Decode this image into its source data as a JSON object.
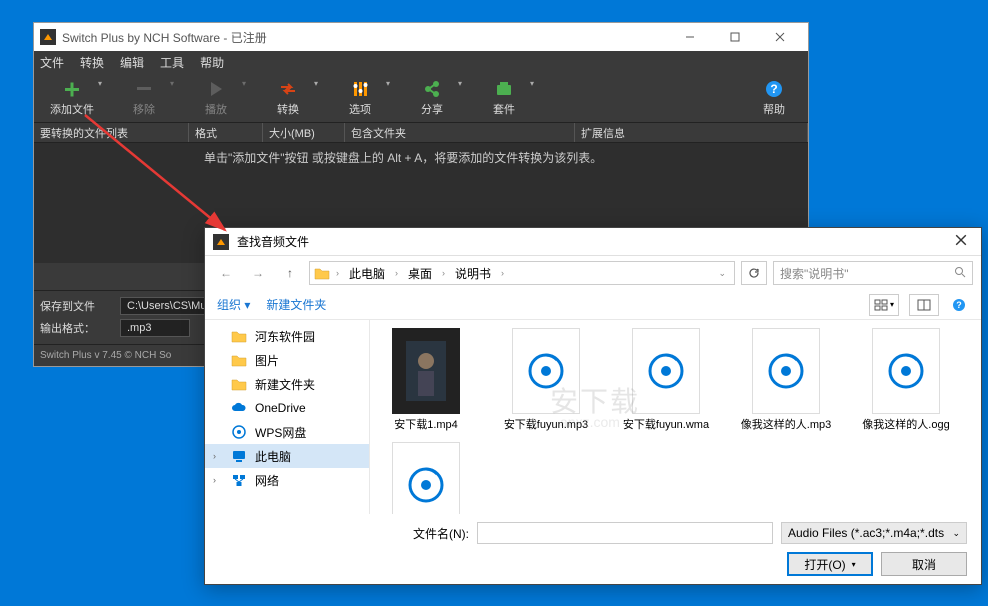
{
  "app": {
    "title": "Switch Plus by NCH Software - 已注册",
    "menu": [
      "文件",
      "转换",
      "编辑",
      "工具",
      "帮助"
    ],
    "toolbar": [
      {
        "k": "add",
        "label": "添加文件",
        "color": "#4caf50"
      },
      {
        "k": "remove",
        "label": "移除",
        "color": "#888",
        "disabled": true
      },
      {
        "k": "play",
        "label": "播放",
        "color": "#888",
        "disabled": true
      },
      {
        "k": "convert",
        "label": "转换",
        "color": "#d84315"
      },
      {
        "k": "options",
        "label": "选项",
        "color": "#ff9800"
      },
      {
        "k": "share",
        "label": "分享",
        "color": "#4caf50"
      },
      {
        "k": "suite",
        "label": "套件",
        "color": "#4caf50"
      }
    ],
    "help_label": "帮助",
    "columns": {
      "list": "要转换的文件列表",
      "format": "格式",
      "size": "大小(MB)",
      "folder": "包含文件夹",
      "ext": "扩展信息"
    },
    "hint": "单击\"添加文件\"按钮 或按键盘上的 Alt + A，将要添加的文件转换为该列表。",
    "nch": "NCH",
    "save_to_label": "保存到文件",
    "save_to_value": "C:\\Users\\CS\\Mu",
    "format_label": "输出格式：",
    "format_value": ".mp3",
    "status": "Switch Plus v 7.45 © NCH So"
  },
  "dialog": {
    "title": "查找音频文件",
    "breadcrumb": [
      "此电脑",
      "桌面",
      "说明书"
    ],
    "search_placeholder": "搜索\"说明书\"",
    "organize": "组织",
    "newfolder": "新建文件夹",
    "sidebar": [
      {
        "label": "河东软件园",
        "icon": "folder"
      },
      {
        "label": "图片",
        "icon": "folder"
      },
      {
        "label": "新建文件夹",
        "icon": "folder"
      },
      {
        "label": "OneDrive",
        "icon": "cloud"
      },
      {
        "label": "WPS网盘",
        "icon": "wps"
      },
      {
        "label": "此电脑",
        "icon": "pc",
        "selected": true,
        "expand": true
      },
      {
        "label": "网络",
        "icon": "network",
        "expand": true
      }
    ],
    "files": [
      {
        "name": "安下载1.mp4",
        "type": "video"
      },
      {
        "name": "安下载fuyun.mp3",
        "type": "audio"
      },
      {
        "name": "安下载fuyun.wma",
        "type": "audio"
      },
      {
        "name": "像我这样的人.mp3",
        "type": "audio"
      },
      {
        "name": "像我这样的人.ogg",
        "type": "audio"
      },
      {
        "name": "",
        "type": "audio"
      }
    ],
    "filename_label": "文件名(N):",
    "filter": "Audio Files (*.ac3;*.m4a;*.dts",
    "open_btn": "打开(O)",
    "cancel_btn": "取消",
    "watermark": "安下载",
    "watermark_url": "anxz.com"
  }
}
